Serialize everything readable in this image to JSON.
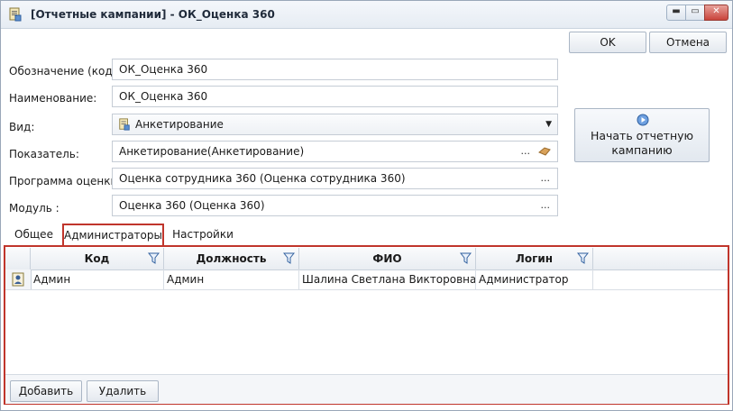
{
  "window": {
    "title": "[Отчетные кампании] - ОК_Оценка 360",
    "min_glyph": "▬",
    "max_glyph": "▭",
    "close_glyph": "✕"
  },
  "actions": {
    "ok": "OK",
    "cancel": "Отмена"
  },
  "form": {
    "code_label": "Обозначение (код):",
    "code_value": "ОК_Оценка 360",
    "name_label": "Наименование:",
    "name_value": "ОК_Оценка 360",
    "type_label": "Вид:",
    "type_value": "Анкетирование",
    "indicator_label": "Показатель:",
    "indicator_value": "Анкетирование(Анкетирование)",
    "program_label": "Программа оценки :",
    "program_value": "Оценка сотрудника 360 (Оценка сотрудника 360)",
    "module_label": "Модуль :",
    "module_value": "Оценка 360 (Оценка 360)",
    "ellipsis": "...",
    "dropdown_arrow": "▼"
  },
  "start_button": {
    "line1": "Начать отчетную",
    "line2": "кампанию"
  },
  "tabs": [
    {
      "label": "Общее"
    },
    {
      "label": "Администраторы"
    },
    {
      "label": "Настройки"
    }
  ],
  "grid": {
    "columns": [
      "Код",
      "Должность",
      "ФИО",
      "Логин"
    ],
    "rows": [
      {
        "code": "Админ",
        "position": "Админ",
        "fio": "Шалина Светлана Викторовна",
        "login": "Администратор"
      }
    ]
  },
  "bottom": {
    "add": "Добавить",
    "delete": "Удалить"
  },
  "icons": {
    "title": "report-campaign-icon",
    "filter": "filter-funnel-icon",
    "start": "play-circle-icon",
    "row": "user-card-icon",
    "indicator_extra": "eraser-icon"
  },
  "colors": {
    "highlight": "#c0352b",
    "accent": "#3a7bd5"
  }
}
